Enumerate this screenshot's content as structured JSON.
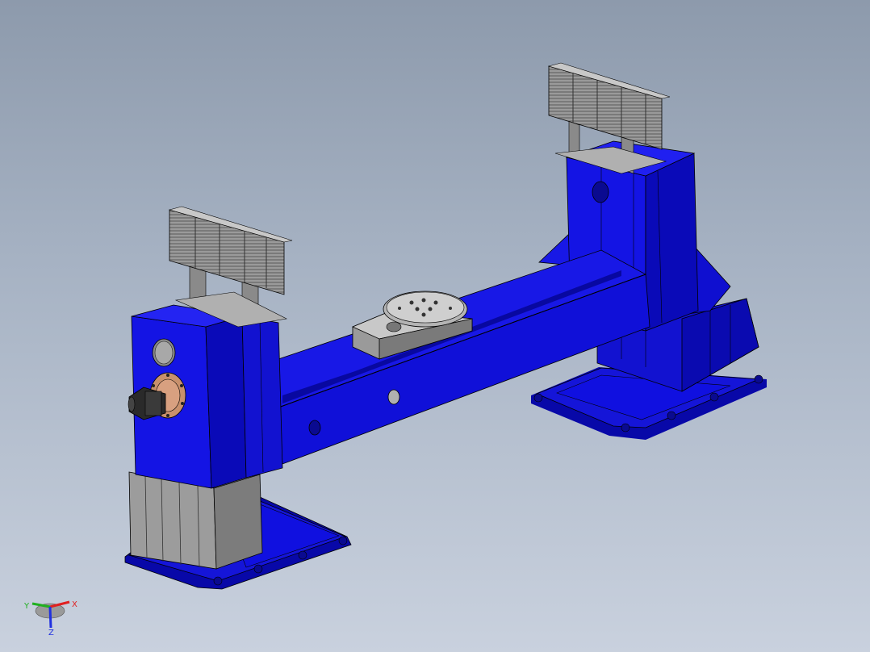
{
  "viewport": {
    "background_top": "#8d9aac",
    "background_bottom": "#c9d1de"
  },
  "model": {
    "frame_color": "#1010e0",
    "frame_shade": "#0808a8",
    "frame_light": "#3030f0",
    "steel_color": "#a8a8a8",
    "steel_dark": "#6e6e6e",
    "motor_color": "#2a2a2a",
    "flange_color": "#d8a080"
  },
  "triad": {
    "x_label": "X",
    "y_label": "Y",
    "z_label": "Z",
    "x_color": "#e02020",
    "y_color": "#20b020",
    "z_color": "#2030e0"
  }
}
